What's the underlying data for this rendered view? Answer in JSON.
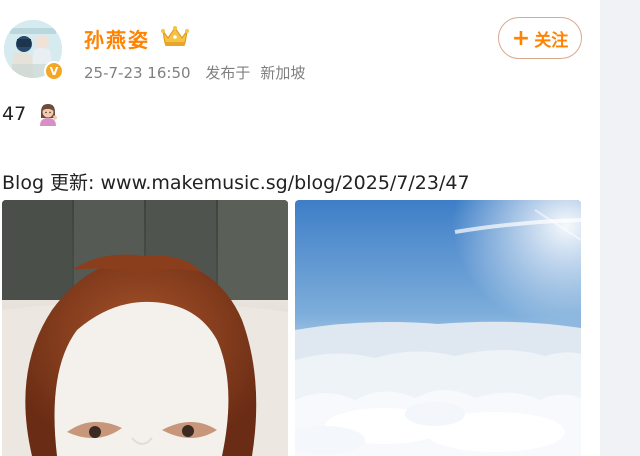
{
  "post": {
    "username": "孙燕姿",
    "date": "25-7-23 16:50",
    "published_prefix": "发布于",
    "location": "新加坡",
    "follow_label": "关注",
    "follow_plus": "+",
    "verified_mark": "V",
    "text_line1": "47",
    "blog_prefix": "Blog 更新: ",
    "blog_link": "www.makemusic.sg/blog/2025/7/23/47"
  },
  "colors": {
    "username": "#ff8200",
    "follow_border": "#d9a98f",
    "verified": "#f5a623",
    "meta": "#808080"
  },
  "icons": {
    "crown": "crown-icon",
    "emoji": "woman-tipping-hand-emoji-icon",
    "verified": "verified-badge-icon"
  },
  "images": [
    {
      "name": "selfie-face-mask-photo"
    },
    {
      "name": "sky-above-clouds-photo"
    }
  ]
}
